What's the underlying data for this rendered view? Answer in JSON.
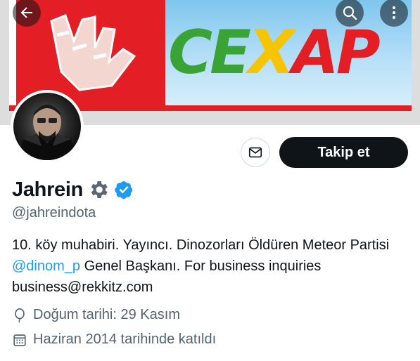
{
  "header": {
    "banner_text_letters": [
      "C",
      "E",
      "X",
      "A",
      "P"
    ],
    "banner_letter_colors": [
      "#3aa335",
      "#3aa335",
      "#f6c400",
      "#e31e24",
      "#e31e24"
    ],
    "back_icon": "arrow-left-icon",
    "search_icon": "search-icon",
    "more_icon": "more-vertical-icon"
  },
  "profile": {
    "display_name": "Jahrein",
    "handle": "@jahreindota",
    "bio_part1": "10. köy muhabiri. Yayıncı. Dinozorları Öldüren Meteor Partisi ",
    "bio_mention": "@dinom_p",
    "bio_part2": " Genel Başkanı. For business inquiries business@rekkitz.com",
    "birthday": "Doğum tarihi: 29 Kasım",
    "joined": "Haziran 2014 tarihinde katıldı",
    "badges": [
      "gear-icon",
      "verified-badge-icon"
    ]
  },
  "actions": {
    "message_icon": "envelope-icon",
    "follow_label": "Takip et"
  },
  "colors": {
    "follow_bg": "#0f1419",
    "verified": "#1d9bf0",
    "secondary_text": "#536471"
  }
}
